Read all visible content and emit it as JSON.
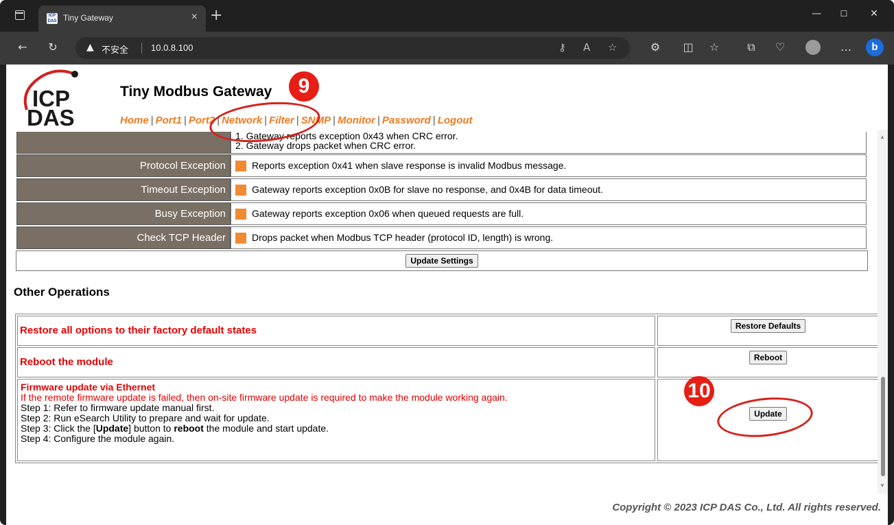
{
  "browser": {
    "tab_title": "Tiny Gateway",
    "tab_close": "×",
    "new_tab": "+",
    "security_warning": "不安全",
    "url": "10.0.8.100",
    "window_controls": {
      "minimize": "—",
      "maximize": "☐",
      "close": "✕"
    }
  },
  "header": {
    "logo_text": "ICP DAS",
    "logo_line1": "ICP",
    "logo_line2": "DAS",
    "title": "Tiny Modbus Gateway",
    "nav": [
      "Home",
      "Port1",
      "Port2",
      "Network",
      "Filter",
      "SNMP",
      "Monitor",
      "Password",
      "Logout"
    ],
    "nav_separator": "|"
  },
  "settings": {
    "crc_lines": [
      "1. Gateway reports exception 0x43 when CRC error.",
      "2. Gateway drops packet when CRC error."
    ],
    "rows": [
      {
        "label": "Protocol Exception",
        "text": "Reports exception 0x41 when slave response is invalid Modbus message."
      },
      {
        "label": "Timeout Exception",
        "text": "Gateway reports exception 0x0B for slave no response, and 0x4B for data timeout."
      },
      {
        "label": "Busy Exception",
        "text": "Gateway reports exception 0x06 when queued requests are full."
      },
      {
        "label": "Check TCP Header",
        "text": "Drops packet when Modbus TCP header (protocol ID, length) is wrong."
      }
    ],
    "update_button": "Update Settings"
  },
  "operations": {
    "heading": "Other Operations",
    "restore_text": "Restore all options to their factory default states",
    "restore_button": "Restore Defaults",
    "reboot_text": "Reboot the module",
    "reboot_button": "Reboot",
    "firmware_title": "Firmware update via Ethernet",
    "firmware_warning": "If the remote firmware update is failed, then on-site firmware update is required to make the module working again.",
    "step1": "Step 1: Refer to firmware update manual first.",
    "step2": "Step 2: Run eSearch Utility to prepare and wait for update.",
    "step3_prefix": "Step 3: Click the [",
    "step3_update": "Update",
    "step3_middle": "] button to ",
    "step3_reboot": "reboot",
    "step3_suffix": " the module and start update.",
    "step4": "Step 4: Configure the module again.",
    "update_button": "Update"
  },
  "footer": {
    "copyright": "Copyright © 2023 ICP DAS Co., Ltd. All rights reserved."
  },
  "annotations": {
    "callout_9": "9",
    "callout_10": "10",
    "color": "#e61e14"
  },
  "colors": {
    "nav_orange": "#ee7a22",
    "label_bg": "#7a6f64",
    "checkbox_orange": "#f08a33",
    "warning_red": "#e60000"
  }
}
